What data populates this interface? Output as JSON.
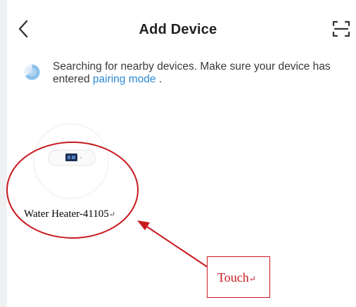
{
  "header": {
    "title": "Add Device",
    "back_icon": "chevron-left-icon",
    "scan_icon": "scan-icon"
  },
  "search": {
    "message_before": "Searching for nearby devices. Make sure your device has entered ",
    "pairing_link": "pairing mode",
    "message_after": " .",
    "spinner_icon": "searching-spinner-icon"
  },
  "devices": [
    {
      "name": "Water Heater-41105",
      "return_mark": "↵",
      "icon": "water-heater-icon"
    }
  ],
  "annotation": {
    "label": "Touch",
    "return_mark": "↵",
    "color": "#c8191e"
  },
  "colors": {
    "accent": "#2e8ad6",
    "annotation": "#c8191e"
  }
}
